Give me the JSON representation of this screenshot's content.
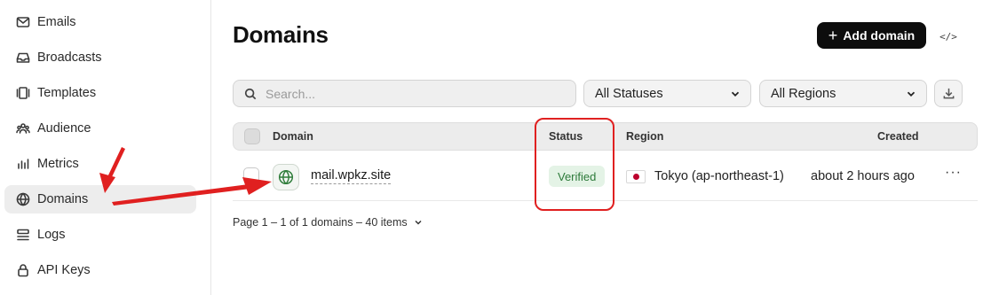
{
  "sidebar": {
    "items": [
      {
        "label": "Emails",
        "icon": "mail-icon"
      },
      {
        "label": "Broadcasts",
        "icon": "inbox-icon"
      },
      {
        "label": "Templates",
        "icon": "templates-icon"
      },
      {
        "label": "Audience",
        "icon": "users-icon"
      },
      {
        "label": "Metrics",
        "icon": "bar-chart-icon"
      },
      {
        "label": "Domains",
        "icon": "globe-icon",
        "active": true
      },
      {
        "label": "Logs",
        "icon": "list-icon"
      },
      {
        "label": "API Keys",
        "icon": "lock-icon"
      }
    ]
  },
  "header": {
    "title": "Domains",
    "add_button_label": "Add domain",
    "code_button_label": "</>"
  },
  "filters": {
    "search_placeholder": "Search...",
    "status_select": "All Statuses",
    "region_select": "All Regions"
  },
  "table": {
    "columns": {
      "domain": "Domain",
      "status": "Status",
      "region": "Region",
      "created": "Created"
    },
    "rows": [
      {
        "domain": "mail.wpkz.site",
        "status": "Verified",
        "region": "Tokyo (ap-northeast-1)",
        "created": "about 2 hours ago",
        "actions": "···"
      }
    ]
  },
  "pagination": {
    "text": "Page 1 – 1 of 1 domains – 40 items"
  },
  "colors": {
    "annotation": "#e02020",
    "status_verified_bg": "#e4f3e6",
    "status_verified_text": "#2d7a3a",
    "primary_button": "#0d0d0d"
  }
}
